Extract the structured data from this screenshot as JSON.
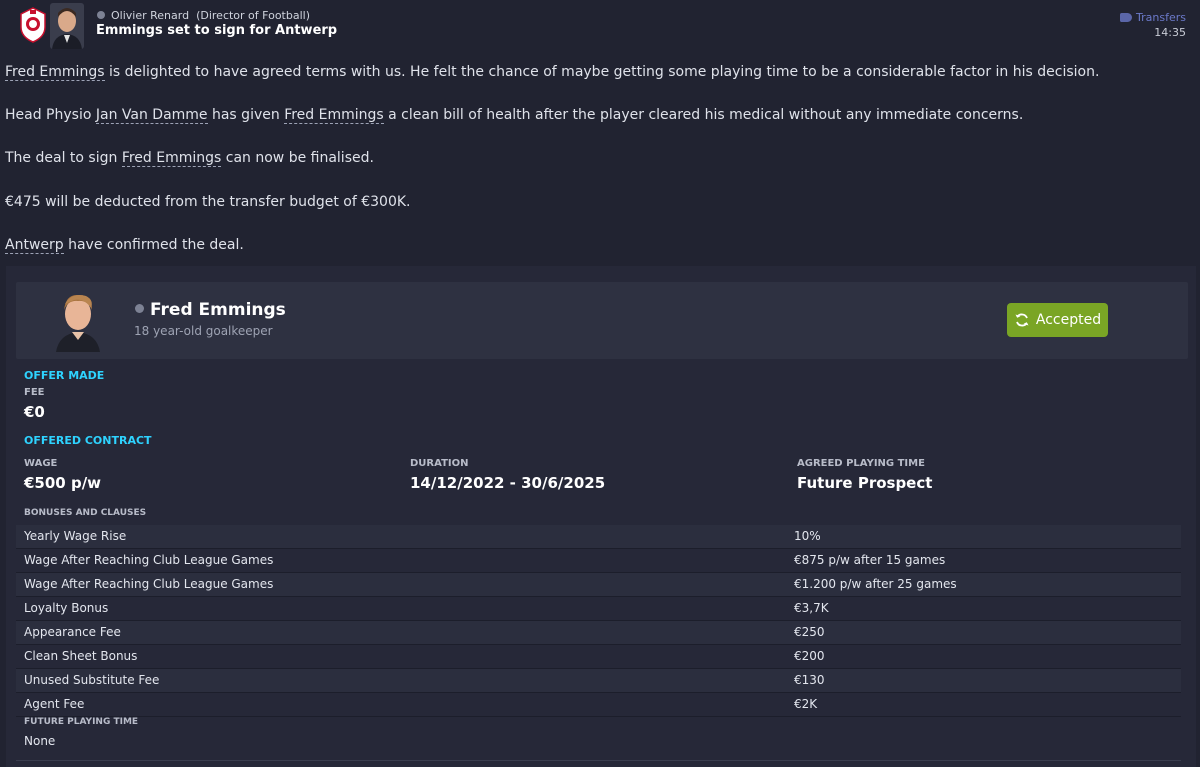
{
  "header": {
    "sender": "Olivier Renard",
    "sender_role": "(Director of Football)",
    "subject": "Emmings set to sign for Antwerp",
    "category": "Transfers",
    "time": "14:35"
  },
  "message": {
    "p1": {
      "link1": "Fred Emmings",
      "text1": " is delighted to have agreed terms with us. He felt the chance of maybe getting some playing time to be a considerable factor in his decision."
    },
    "p2": {
      "text1": "Head Physio ",
      "link1": "Jan Van Damme",
      "text2": " has given ",
      "link2": "Fred Emmings",
      "text3": " a clean bill of health after the player cleared his medical without any immediate concerns."
    },
    "p3": {
      "text1": "The deal to sign ",
      "link1": "Fred Emmings",
      "text2": " can now be finalised."
    },
    "p4": {
      "text1": "€475 will be deducted from the transfer budget of €300K."
    },
    "p5": {
      "link1": "Antwerp",
      "text1": " have confirmed the deal."
    }
  },
  "player": {
    "name": "Fred Emmings",
    "description": "18 year-old goalkeeper",
    "status_label": "Accepted"
  },
  "offer": {
    "section_title": "OFFER MADE",
    "fee_label": "FEE",
    "fee_value": "€0"
  },
  "contract": {
    "section_title": "OFFERED CONTRACT",
    "wage_label": "WAGE",
    "wage_value": "€500 p/w",
    "duration_label": "DURATION",
    "duration_value": "14/12/2022 - 30/6/2025",
    "playing_time_label": "AGREED PLAYING TIME",
    "playing_time_value": "Future Prospect",
    "clauses_label": "BONUSES AND CLAUSES",
    "clauses": [
      {
        "name": "Yearly Wage Rise",
        "value": "10%"
      },
      {
        "name": "Wage After Reaching Club League Games",
        "value": "€875 p/w after 15 games"
      },
      {
        "name": "Wage After Reaching Club League Games",
        "value": "€1.200 p/w after 25 games"
      },
      {
        "name": "Loyalty Bonus",
        "value": "€3,7K"
      },
      {
        "name": "Appearance Fee",
        "value": "€250"
      },
      {
        "name": "Clean Sheet Bonus",
        "value": "€200"
      },
      {
        "name": "Unused Substitute Fee",
        "value": "€130"
      },
      {
        "name": "Agent Fee",
        "value": "€2K"
      }
    ],
    "future_playing_time_label": "FUTURE PLAYING TIME",
    "future_playing_time_value": "None"
  },
  "colors": {
    "background": "#212331",
    "card": "#262838",
    "accent_cyan": "#2ed3ff",
    "accepted_green": "#7aa525",
    "category_blue": "#6b79c9"
  },
  "icons": {
    "crest": "club-crest-icon",
    "online": "online-status-icon",
    "tag": "tag-icon",
    "accepted": "refresh-icon"
  }
}
